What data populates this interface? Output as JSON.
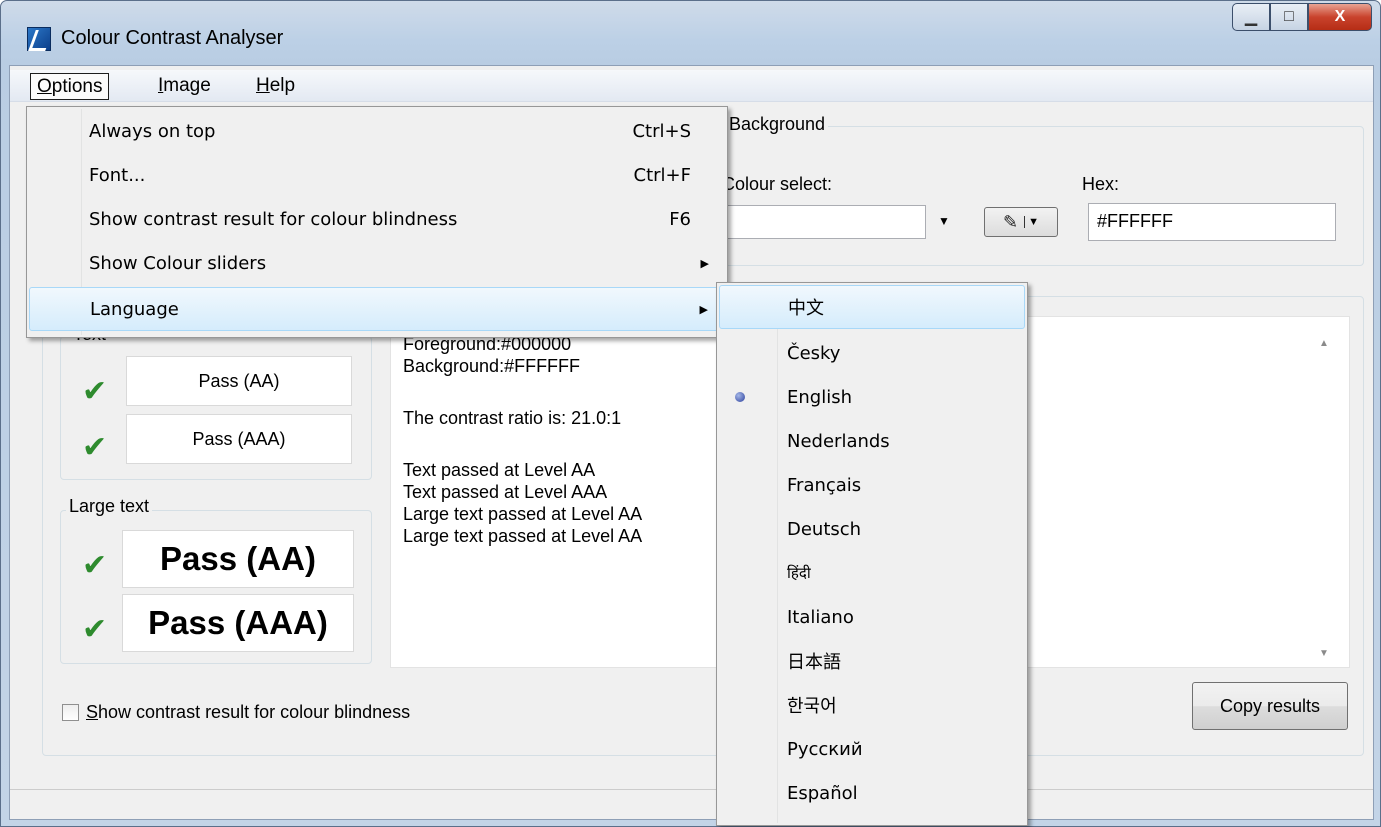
{
  "window": {
    "title": "Colour Contrast Analyser",
    "buttons": {
      "minimize": "▁",
      "maximize": "□",
      "close": "X"
    }
  },
  "menubar": {
    "options": {
      "pre": "",
      "u": "O",
      "post": "ptions"
    },
    "image": {
      "pre": "",
      "u": "I",
      "post": "mage"
    },
    "help": {
      "pre": "",
      "u": "H",
      "post": "elp"
    }
  },
  "options_menu": {
    "items": [
      {
        "label": "Always on top",
        "shortcut": "Ctrl+S"
      },
      {
        "label": "Font...",
        "shortcut": "Ctrl+F"
      },
      {
        "label": "Show contrast result for colour blindness",
        "shortcut": "F6"
      },
      {
        "label": "Show Colour sliders",
        "submenu": "▶"
      },
      {
        "label": "Language",
        "submenu": "▶"
      }
    ]
  },
  "language_menu": {
    "selected": "English",
    "items": [
      "中文",
      "Česky",
      "English",
      "Nederlands",
      "Français",
      "Deutsch",
      "हिंदी",
      "Italiano",
      "日本語",
      "한국어",
      "Русский",
      "Español"
    ]
  },
  "background": {
    "group_label": "Background",
    "colour_select_label": "Colour select:",
    "hex_label": "Hex:",
    "hex_value": "#FFFFFF",
    "combo_arrow": "▼",
    "picker_arrow": "▼"
  },
  "results": {
    "text_group_label": "Text",
    "text_aa": "Pass (AA)",
    "text_aaa": "Pass (AAA)",
    "large_group_label": "Large text",
    "large_aa": "Pass (AA)",
    "large_aaa": "Pass (AAA)",
    "check_mark": "✔",
    "lines": [
      "Foreground:#000000",
      "Background:#FFFFFF",
      "",
      "The contrast ratio is: 21.0:1",
      "",
      "Text passed at Level AA",
      "Text passed at Level AAA",
      "Large text passed at Level AA",
      "Large text passed at Level AA"
    ],
    "scroll_up": "▲",
    "scroll_down": "▼"
  },
  "footer": {
    "colour_blindness_checkbox": {
      "u": "S",
      "rest": "how contrast result for colour blindness"
    },
    "copy_button": "Copy results"
  }
}
